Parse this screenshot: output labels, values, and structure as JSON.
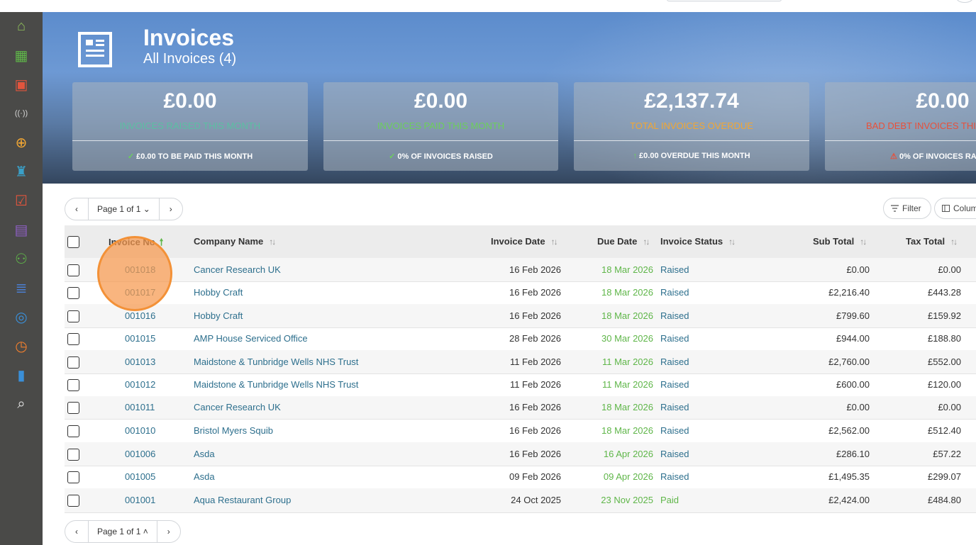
{
  "header": {
    "title": "Invoices",
    "subtitle": "All Invoices (4)"
  },
  "sidebar": {
    "items": [
      {
        "icon": "home-icon",
        "color": "#8fbf5a"
      },
      {
        "icon": "building-icon",
        "color": "#5fb649"
      },
      {
        "icon": "contact-card-icon",
        "color": "#e2553d"
      },
      {
        "icon": "broadcast-icon",
        "color": "#d6d6d6"
      },
      {
        "icon": "target-icon",
        "color": "#f2a733"
      },
      {
        "icon": "trophy-icon",
        "color": "#3aa0c8"
      },
      {
        "icon": "checkbox-icon",
        "color": "#e2553d"
      },
      {
        "icon": "briefcase-icon",
        "color": "#8e5fc4"
      },
      {
        "icon": "users-icon",
        "color": "#5fb649"
      },
      {
        "icon": "invoice-doc-icon",
        "color": "#4b7fd1"
      },
      {
        "icon": "coins-icon",
        "color": "#3a8fd8"
      },
      {
        "icon": "clock-icon",
        "color": "#f07f2e"
      },
      {
        "icon": "bar-chart-icon",
        "color": "#3a8fd8"
      },
      {
        "icon": "search-icon",
        "color": "#e6e6e6"
      }
    ]
  },
  "stats": [
    {
      "amount": "£0.00",
      "label": "INVOICES RAISED THIS MONTH",
      "label_color": "#5bbfa2",
      "foot_icon": "✓",
      "foot_icon_color": "#6bcf5c",
      "foot": "£0.00 TO BE PAID THIS MONTH"
    },
    {
      "amount": "£0.00",
      "label": "INVOICES PAID THIS MONTH",
      "label_color": "#6ccf5b",
      "foot_icon": "✓",
      "foot_icon_color": "#6bcf5c",
      "foot": "0% OF INVOICES RAISED"
    },
    {
      "amount": "£2,137.74",
      "label": "TOTAL INVOICES OVERDUE",
      "label_color": "#f2a733",
      "foot_icon": "↑",
      "foot_icon_color": "#6bcf5c",
      "foot": "£0.00 OVERDUE THIS MONTH"
    },
    {
      "amount": "£0.00",
      "label": "BAD DEBT INVOICES THIS",
      "label_color": "#e8503a",
      "foot_icon": "⚠",
      "foot_icon_color": "#e8503a",
      "foot": "0% OF INVOICES RA"
    }
  ],
  "pager": {
    "prev": "‹",
    "next": "›",
    "label_top": "Page 1 of 1 ⌄",
    "label_bottom": "Page 1 of 1 ˄"
  },
  "toolbar": {
    "filter_label": "Filter",
    "columns_label": "Colum"
  },
  "table": {
    "columns": {
      "invoice_no": "Invoice No",
      "company": "Company Name",
      "invoice_date": "Invoice Date",
      "due_date": "Due Date",
      "status": "Invoice Status",
      "sub_total": "Sub Total",
      "tax_total": "Tax Total"
    },
    "rows": [
      {
        "no": "001018",
        "company": "Cancer Research UK",
        "invoice_date": "16 Feb 2026",
        "due_date": "18 Mar 2026",
        "status": "Raised",
        "sub_total": "£0.00",
        "tax_total": "£0.00"
      },
      {
        "no": "001017",
        "company": "Hobby Craft",
        "invoice_date": "16 Feb 2026",
        "due_date": "18 Mar 2026",
        "status": "Raised",
        "sub_total": "£2,216.40",
        "tax_total": "£443.28"
      },
      {
        "no": "001016",
        "company": "Hobby Craft",
        "invoice_date": "16 Feb 2026",
        "due_date": "18 Mar 2026",
        "status": "Raised",
        "sub_total": "£799.60",
        "tax_total": "£159.92"
      },
      {
        "no": "001015",
        "company": "AMP House Serviced Office",
        "invoice_date": "28 Feb 2026",
        "due_date": "30 Mar 2026",
        "status": "Raised",
        "sub_total": "£944.00",
        "tax_total": "£188.80"
      },
      {
        "no": "001013",
        "company": "Maidstone & Tunbridge Wells NHS Trust",
        "invoice_date": "11 Feb 2026",
        "due_date": "11 Mar 2026",
        "status": "Raised",
        "sub_total": "£2,760.00",
        "tax_total": "£552.00"
      },
      {
        "no": "001012",
        "company": "Maidstone & Tunbridge Wells NHS Trust",
        "invoice_date": "11 Feb 2026",
        "due_date": "11 Mar 2026",
        "status": "Raised",
        "sub_total": "£600.00",
        "tax_total": "£120.00"
      },
      {
        "no": "001011",
        "company": "Cancer Research UK",
        "invoice_date": "16 Feb 2026",
        "due_date": "18 Mar 2026",
        "status": "Raised",
        "sub_total": "£0.00",
        "tax_total": "£0.00"
      },
      {
        "no": "001010",
        "company": "Bristol Myers Squib",
        "invoice_date": "16 Feb 2026",
        "due_date": "18 Mar 2026",
        "status": "Raised",
        "sub_total": "£2,562.00",
        "tax_total": "£512.40"
      },
      {
        "no": "001006",
        "company": "Asda",
        "invoice_date": "16 Feb 2026",
        "due_date": "16 Apr 2026",
        "status": "Raised",
        "sub_total": "£286.10",
        "tax_total": "£57.22"
      },
      {
        "no": "001005",
        "company": "Asda",
        "invoice_date": "09 Feb 2026",
        "due_date": "09 Apr 2026",
        "status": "Raised",
        "sub_total": "£1,495.35",
        "tax_total": "£299.07"
      },
      {
        "no": "001001",
        "company": "Aqua Restaurant Group",
        "invoice_date": "24 Oct 2025",
        "due_date": "23 Nov 2025",
        "status": "Paid",
        "sub_total": "£2,424.00",
        "tax_total": "£484.80"
      }
    ]
  },
  "colors": {
    "link": "#2d6f8d",
    "due_green": "#5fb649",
    "sort_active": "#5fb649",
    "highlight": "#f39137"
  }
}
